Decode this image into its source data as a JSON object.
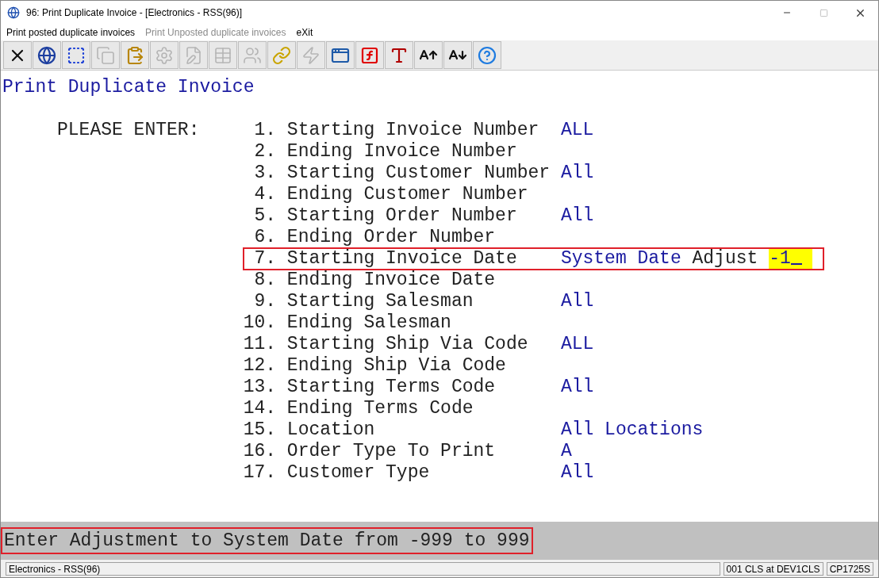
{
  "window": {
    "title": "96: Print Duplicate Invoice - [Electronics - RSS(96)]"
  },
  "menu": [
    {
      "label": "Print posted duplicate invoices",
      "disabled": false
    },
    {
      "label": "Print Unposted duplicate invoices",
      "disabled": true
    },
    {
      "label": "eXit",
      "disabled": false
    }
  ],
  "toolbar": [
    {
      "kind": "close",
      "disabled": false
    },
    {
      "kind": "globe",
      "disabled": false
    },
    {
      "kind": "select",
      "disabled": false
    },
    {
      "kind": "copy",
      "disabled": true
    },
    {
      "kind": "paste",
      "disabled": false
    },
    {
      "kind": "settings",
      "disabled": true
    },
    {
      "kind": "edit",
      "disabled": true
    },
    {
      "kind": "table",
      "disabled": true
    },
    {
      "kind": "users",
      "disabled": true
    },
    {
      "kind": "link",
      "disabled": false
    },
    {
      "kind": "bolt",
      "disabled": true
    },
    {
      "kind": "window-bolt",
      "disabled": false
    },
    {
      "kind": "function",
      "disabled": false
    },
    {
      "kind": "font",
      "disabled": false
    },
    {
      "kind": "font-up",
      "disabled": false
    },
    {
      "kind": "font-down",
      "disabled": false
    },
    {
      "kind": "help",
      "disabled": false
    }
  ],
  "screen": {
    "heading": "Print Duplicate Invoice",
    "prompt": "PLEASE ENTER:",
    "fields": [
      {
        "number": "1.",
        "label": "Starting Invoice Number",
        "value": "ALL",
        "selected": false
      },
      {
        "number": "2.",
        "label": "Ending Invoice Number",
        "selected": false
      },
      {
        "number": "3.",
        "label": "Starting Customer Number",
        "value": "All",
        "selected": false
      },
      {
        "number": "4.",
        "label": "Ending Customer Number",
        "selected": false
      },
      {
        "number": "5.",
        "label": "Starting Order Number",
        "value": "All",
        "selected": false
      },
      {
        "number": "6.",
        "label": "Ending Order Number",
        "selected": false
      },
      {
        "number": "7.",
        "label": "Starting Invoice Date",
        "value": "System Date",
        "suffix": "Adjust",
        "input": "-1",
        "selected": true
      },
      {
        "number": "8.",
        "label": "Ending Invoice Date",
        "selected": false
      },
      {
        "number": "9.",
        "label": "Starting Salesman",
        "value": "All",
        "selected": false
      },
      {
        "number": "10.",
        "label": "Ending Salesman",
        "selected": false
      },
      {
        "number": "11.",
        "label": "Starting Ship Via Code",
        "value": "ALL",
        "selected": false
      },
      {
        "number": "12.",
        "label": "Ending Ship Via Code",
        "selected": false
      },
      {
        "number": "13.",
        "label": "Starting Terms Code",
        "value": "All",
        "selected": false
      },
      {
        "number": "14.",
        "label": "Ending Terms Code",
        "selected": false
      },
      {
        "number": "15.",
        "label": "Location",
        "value": "All Locations",
        "selected": false
      },
      {
        "number": "16.",
        "label": "Order Type To Print",
        "value": "A",
        "selected": false
      },
      {
        "number": "17.",
        "label": "Customer Type",
        "value": "All",
        "selected": false
      }
    ],
    "message": "Enter Adjustment to System Date from -999 to 999"
  },
  "status_bar": [
    "Electronics - RSS(96)",
    "001 CLS at DEV1CLS",
    "CP1725S"
  ]
}
